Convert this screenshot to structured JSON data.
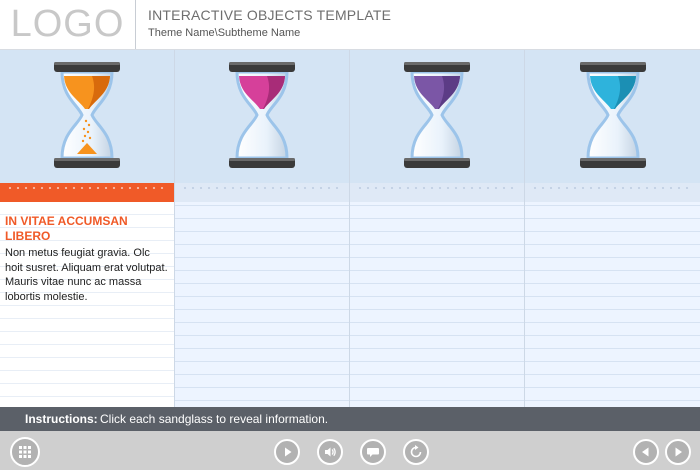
{
  "header": {
    "logo": "LOGO",
    "title": "INTERACTIVE OBJECTS TEMPLATE",
    "subtitle": "Theme Name\\Subtheme Name"
  },
  "columns": [
    {
      "sand_color": "#f7931e",
      "sand_dark": "#d86a0c",
      "active": true
    },
    {
      "sand_color": "#d6409a",
      "sand_dark": "#a82c78",
      "active": false
    },
    {
      "sand_color": "#7b56a6",
      "sand_dark": "#5c3c86",
      "active": false
    },
    {
      "sand_color": "#2eb3dc",
      "sand_dark": "#1b8fb4",
      "active": false
    }
  ],
  "info": {
    "title": "IN VITAE ACCUMSAN LIBERO",
    "text": "Non metus feugiat gravia. Olc hoit susret. Aliquam erat volutpat. Mauris vitae nunc ac massa lobortis molestie."
  },
  "instructions": {
    "label": "Instructions:",
    "text": "Click each sandglass to reveal information."
  },
  "controls": [
    "menu-icon",
    "play-icon",
    "volume-icon",
    "caption-icon",
    "replay-icon",
    "previous-icon",
    "next-icon"
  ],
  "colors": {
    "accent": "#f05a28",
    "panel": "#d4e4f4",
    "bar": "#5b6068"
  }
}
